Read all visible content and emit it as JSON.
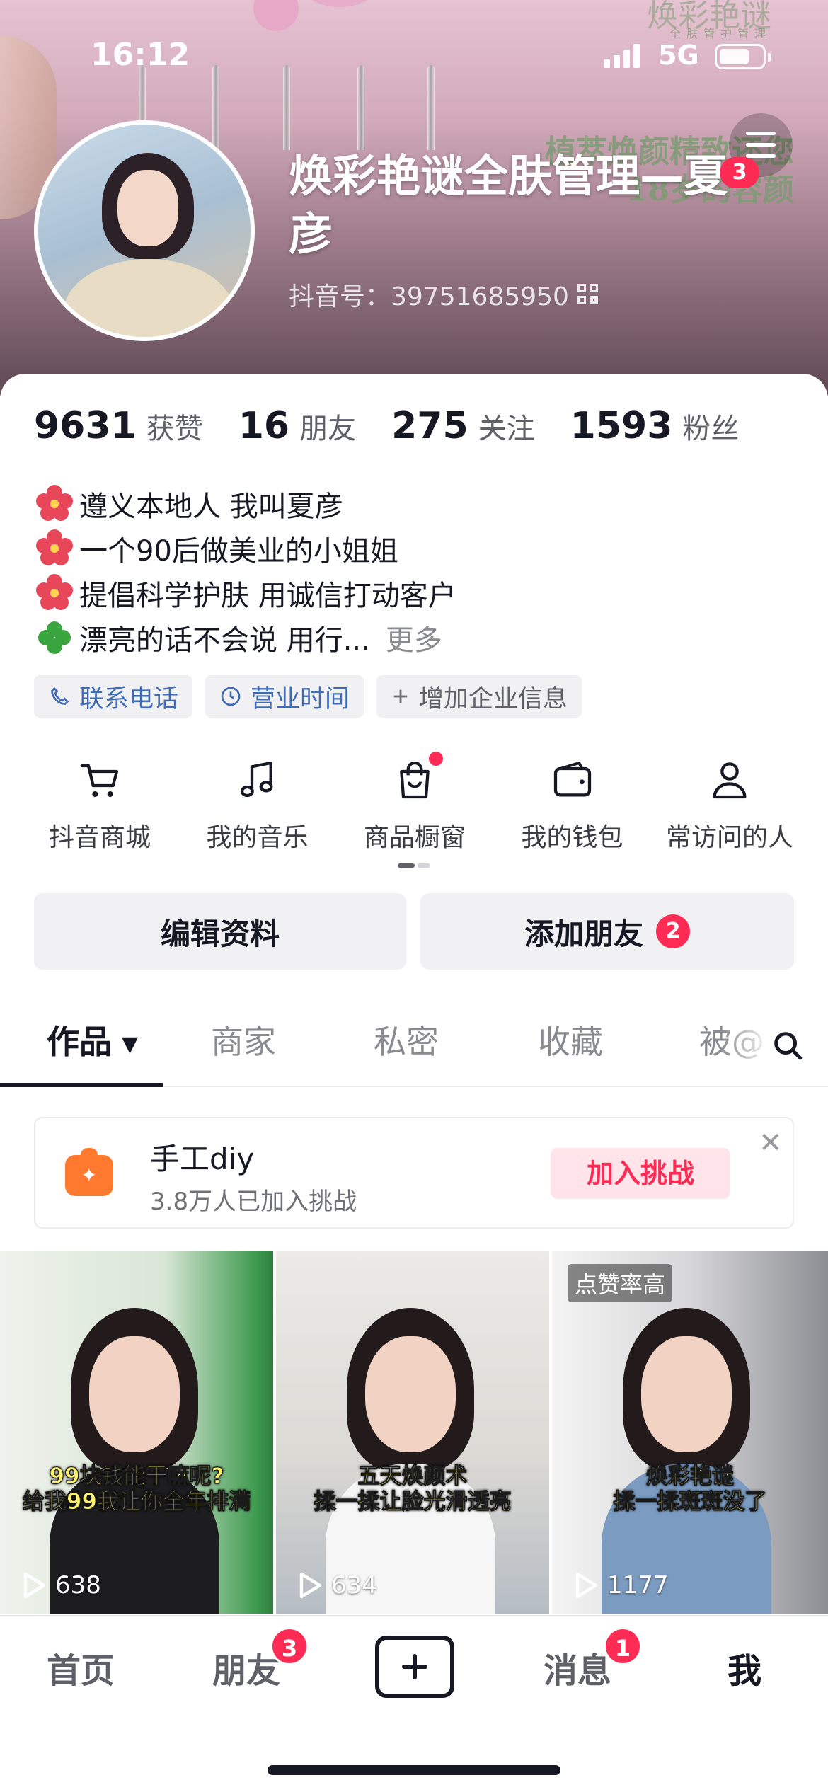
{
  "status_bar": {
    "time": "16:12",
    "network": "5G",
    "battery_level": 0.7
  },
  "header_bg": {
    "wall_logo": "焕彩艳谜",
    "wall_logo_sub": "全肤管护管理",
    "wall_text": "植萃焕颜精致还您18岁的容颜"
  },
  "profile": {
    "display_name": "焕彩艳谜全肤管理—夏彦",
    "douyin_id_label": "抖音号：39751685950",
    "menu_badge": "3"
  },
  "stats": [
    {
      "value": "9631",
      "label": "获赞"
    },
    {
      "value": "16",
      "label": "朋友"
    },
    {
      "value": "275",
      "label": "关注"
    },
    {
      "value": "1593",
      "label": "粉丝"
    }
  ],
  "bio": {
    "lines": [
      "遵义本地人 我叫夏彦",
      "一个90后做美业的小姐姐",
      "提倡科学护肤 用诚信打动客户",
      "漂亮的话不会说  用行..."
    ],
    "emoji_icons": [
      "hibiscus-icon",
      "hibiscus-icon",
      "hibiscus-icon",
      "clover-icon"
    ],
    "more_label": "更多"
  },
  "tags": [
    {
      "label": "联系电话",
      "icon": "phone-icon"
    },
    {
      "label": "营业时间",
      "icon": "clock-icon"
    },
    {
      "label": "增加企业信息",
      "icon": "plus-icon"
    }
  ],
  "shortcuts": [
    {
      "label": "抖音商城",
      "icon": "cart-icon"
    },
    {
      "label": "我的音乐",
      "icon": "music-note-icon"
    },
    {
      "label": "商品橱窗",
      "icon": "shopping-bag-icon",
      "has_dot": true
    },
    {
      "label": "我的钱包",
      "icon": "wallet-icon"
    },
    {
      "label": "常访问的人",
      "icon": "person-icon"
    }
  ],
  "buttons": {
    "edit_profile": "编辑资料",
    "add_friend": "添加朋友",
    "add_friend_badge": "2"
  },
  "content_tabs": [
    {
      "label": "作品",
      "active": true
    },
    {
      "label": "商家"
    },
    {
      "label": "私密"
    },
    {
      "label": "收藏"
    },
    {
      "label": "被@"
    }
  ],
  "challenge": {
    "title": "手工diy",
    "subtitle": "3.8万人已加入挑战",
    "join_label": "加入挑战",
    "close_glyph": "✕"
  },
  "videos": [
    {
      "caption_1": "99块钱能干嘛呢?",
      "caption_2": "给我99我让你全年排满",
      "plays": "638"
    },
    {
      "caption_1": "五天焕颜术",
      "caption_2": "揉一揉让脸光滑透亮",
      "plays": "634"
    },
    {
      "caption_1": "焕彩艳谜",
      "caption_2": "揉一揉斑斑没了",
      "plays": "1177",
      "label": "点赞率高"
    }
  ],
  "bottom_nav": {
    "home": "首页",
    "friends": "朋友",
    "friends_badge": "3",
    "messages": "消息",
    "messages_badge": "1",
    "me": "我"
  },
  "colors": {
    "accent_red": "#fe2c55",
    "text_primary": "#161823",
    "tag_blue": "#3f6bb5"
  }
}
